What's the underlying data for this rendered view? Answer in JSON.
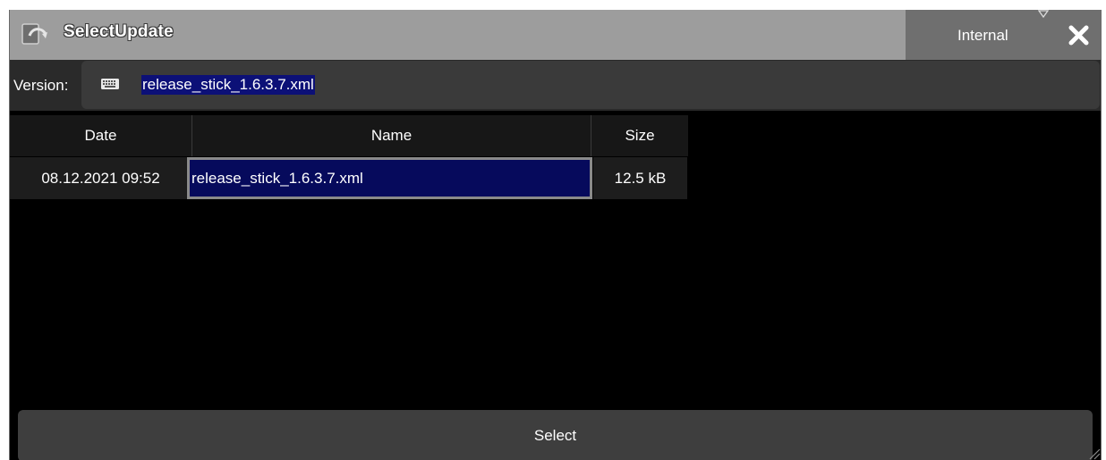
{
  "window": {
    "title": "SelectUpdate",
    "storage_selected": "Internal",
    "icons": [
      "update-icon",
      "dropdown-caret-icon",
      "close-icon"
    ]
  },
  "version": {
    "label": "Version:",
    "value": "release_stick_1.6.3.7.xml",
    "icon": "keyboard-icon"
  },
  "table": {
    "columns": [
      "Date",
      "Name",
      "Size"
    ],
    "rows": [
      {
        "date": "08.12.2021 09:52",
        "name": "release_stick_1.6.3.7.xml",
        "size": "12.5 kB"
      }
    ]
  },
  "actions": {
    "select_label": "Select"
  },
  "colors": {
    "titlebar": "#9d9d9d",
    "selection": "#060a5c",
    "background": "#000000",
    "button": "#3e3e3e"
  }
}
